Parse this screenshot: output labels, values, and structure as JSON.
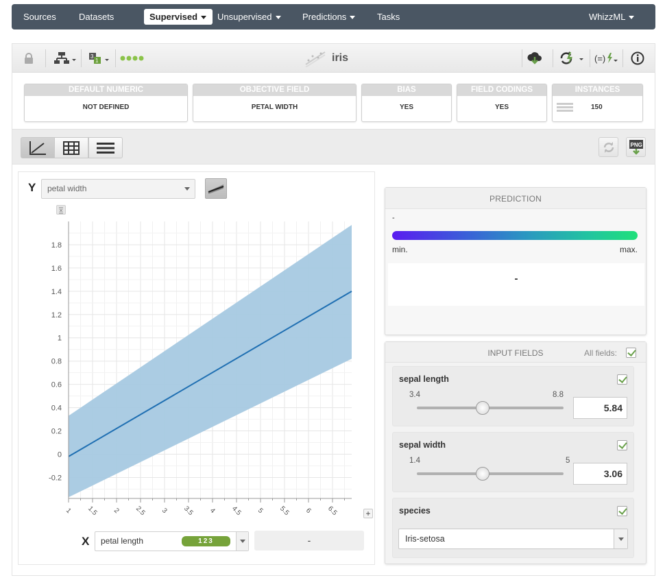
{
  "nav": {
    "items": [
      {
        "label": "Sources",
        "left": 17
      },
      {
        "label": "Datasets",
        "left": 98
      },
      {
        "label": "Unsupervised",
        "left": 300,
        "caret": true
      },
      {
        "label": "Predictions",
        "left": 424,
        "caret": true
      },
      {
        "label": "Tasks",
        "left": 533
      }
    ],
    "active": "Supervised",
    "user": "WhizzML"
  },
  "toolbar": {
    "title": "iris"
  },
  "summary": [
    {
      "header": "DEFAULT NUMERIC",
      "value": "NOT DEFINED"
    },
    {
      "header": "OBJECTIVE FIELD",
      "value": "PETAL WIDTH"
    },
    {
      "header": "BIAS",
      "value": "YES"
    },
    {
      "header": "FIELD CODINGS",
      "value": "YES"
    },
    {
      "header": "INSTANCES",
      "value": "150"
    }
  ],
  "chart": {
    "y_letter": "Y",
    "x_letter": "X",
    "y_field": "petal width",
    "x_field": "petal length",
    "x_type_badge": "123",
    "x_value": "-"
  },
  "chart_data": {
    "type": "line",
    "x_ticks": [
      "1",
      "1.5",
      "2",
      "2.5",
      "3",
      "3.5",
      "4",
      "4.5",
      "5",
      "5.5",
      "6",
      "6.5"
    ],
    "y_ticks": [
      "-0.2",
      "0",
      "0.2",
      "0.4",
      "0.6",
      "0.8",
      "1",
      "1.2",
      "1.4",
      "1.6",
      "1.8"
    ],
    "xlim": [
      1,
      6.9
    ],
    "ylim": [
      -0.38,
      2.0
    ],
    "series": [
      {
        "x": [
          1,
          6.9
        ],
        "y": [
          -0.02,
          1.4
        ]
      }
    ],
    "band": {
      "x": [
        1,
        6.9
      ],
      "lower": [
        -0.37,
        0.82
      ],
      "upper": [
        0.33,
        1.97
      ]
    },
    "colors": {
      "line": "#1f6fb2",
      "band": "#a6c9e2"
    }
  },
  "prediction": {
    "header": "PREDICTION",
    "value_top": "-",
    "min_label": "min.",
    "max_label": "max.",
    "value": "-"
  },
  "inputs": {
    "header": "INPUT FIELDS",
    "all_fields_label": "All fields:",
    "fields": [
      {
        "name": "sepal length",
        "min": "3.4",
        "max": "8.8",
        "value": "5.84",
        "fraction": 0.45
      },
      {
        "name": "sepal width",
        "min": "1.4",
        "max": "5",
        "value": "3.06",
        "fraction": 0.45
      },
      {
        "name": "species",
        "selected": "Iris-setosa"
      }
    ]
  }
}
